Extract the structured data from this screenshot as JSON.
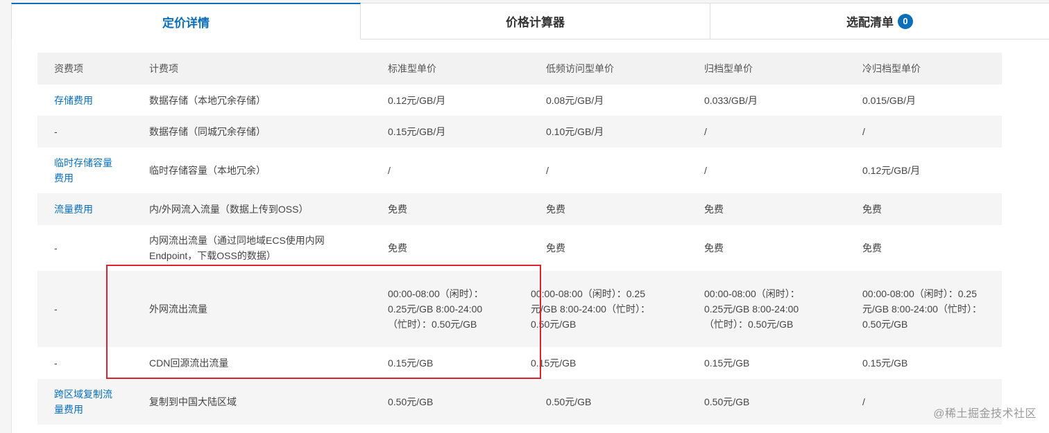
{
  "tabs": {
    "pricing_details": "定价详情",
    "price_calculator": "价格计算器",
    "selection_list": "选配清单",
    "selection_count": "0"
  },
  "table": {
    "headers": [
      "资费项",
      "计费项",
      "标准型单价",
      "低频访问型单价",
      "归档型单价",
      "冷归档型单价"
    ],
    "rows": [
      {
        "fee": "存储费用",
        "fee_link": true,
        "item": "数据存储（本地冗余存储）",
        "standard": "0.12元/GB/月",
        "infrequent": "0.08元/GB/月",
        "archive": "0.033/GB/月",
        "cold_archive": "0.015/GB/月"
      },
      {
        "fee": "-",
        "fee_link": false,
        "item": "数据存储（同城冗余存储）",
        "standard": "0.15元/GB/月",
        "infrequent": "0.10元/GB/月",
        "archive": "/",
        "cold_archive": "/"
      },
      {
        "fee": "临时存储容量费用",
        "fee_link": true,
        "item": "临时存储容量（本地冗余）",
        "standard": "/",
        "infrequent": "/",
        "archive": "/",
        "cold_archive": "0.12元/GB/月"
      },
      {
        "fee": "流量费用",
        "fee_link": true,
        "item": "内/外网流入流量（数据上传到OSS）",
        "standard": "免费",
        "infrequent": "免费",
        "archive": "免费",
        "cold_archive": "免费"
      },
      {
        "fee": "-",
        "fee_link": false,
        "item": "内网流出流量（通过同地域ECS使用内网Endpoint，下载OSS的数据）",
        "standard": "免费",
        "infrequent": "免费",
        "archive": "免费",
        "cold_archive": "免费"
      },
      {
        "fee": "-",
        "fee_link": false,
        "item": "外网流出流量",
        "standard": "00:00-08:00（闲时）：0.25元/GB 8:00-24:00（忙时）：0.50元/GB",
        "infrequent": "00:00-08:00（闲时）：0.25元/GB 8:00-24:00（忙时）：0.50元/GB",
        "archive": "00:00-08:00（闲时）：0.25元/GB 8:00-24:00（忙时）：0.50元/GB",
        "cold_archive": "00:00-08:00（闲时）：0.25元/GB 8:00-24:00（忙时）：0.50元/GB"
      },
      {
        "fee": "-",
        "fee_link": false,
        "item": "CDN回源流出流量",
        "standard": "0.15元/GB",
        "infrequent": "0.15元/GB",
        "archive": "0.15元/GB",
        "cold_archive": "0.15元/GB"
      },
      {
        "fee": "跨区域复制流量费用",
        "fee_link": true,
        "item": "复制到中国大陆区域",
        "standard": "0.50元/GB",
        "infrequent": "0.50元/GB",
        "archive": "0.50元/GB",
        "cold_archive": "/"
      }
    ]
  },
  "watermark": "@稀土掘金技术社区",
  "colors": {
    "accent": "#0a6fb8",
    "highlight_box": "#d9252e"
  }
}
